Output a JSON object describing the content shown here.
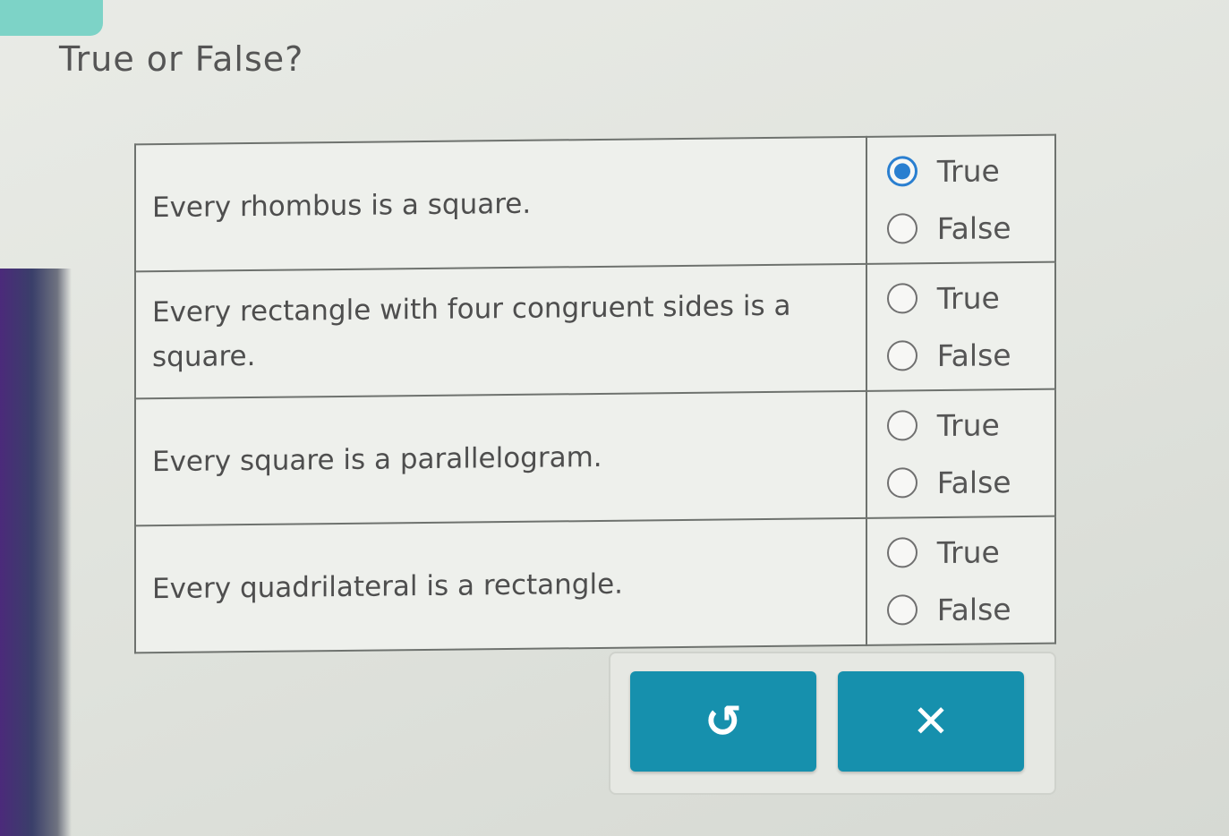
{
  "question": {
    "title": "True or False?"
  },
  "rows": [
    {
      "statement": "Every rhombus is a square.",
      "options": [
        {
          "label": "True",
          "selected": true
        },
        {
          "label": "False",
          "selected": false
        }
      ]
    },
    {
      "statement": "Every rectangle with four congruent sides is a square.",
      "options": [
        {
          "label": "True",
          "selected": false
        },
        {
          "label": "False",
          "selected": false
        }
      ]
    },
    {
      "statement": "Every square is a parallelogram.",
      "options": [
        {
          "label": "True",
          "selected": false
        },
        {
          "label": "False",
          "selected": false
        }
      ]
    },
    {
      "statement": "Every quadrilateral is a rectangle.",
      "options": [
        {
          "label": "True",
          "selected": false
        },
        {
          "label": "False",
          "selected": false
        }
      ]
    }
  ],
  "buttons": {
    "undo": {
      "icon": "undo-icon",
      "glyph": "↺"
    },
    "clear": {
      "icon": "close-icon",
      "glyph": "✕"
    }
  },
  "colors": {
    "accent": "#1690ad",
    "radio_selected": "#2a7fd0"
  }
}
